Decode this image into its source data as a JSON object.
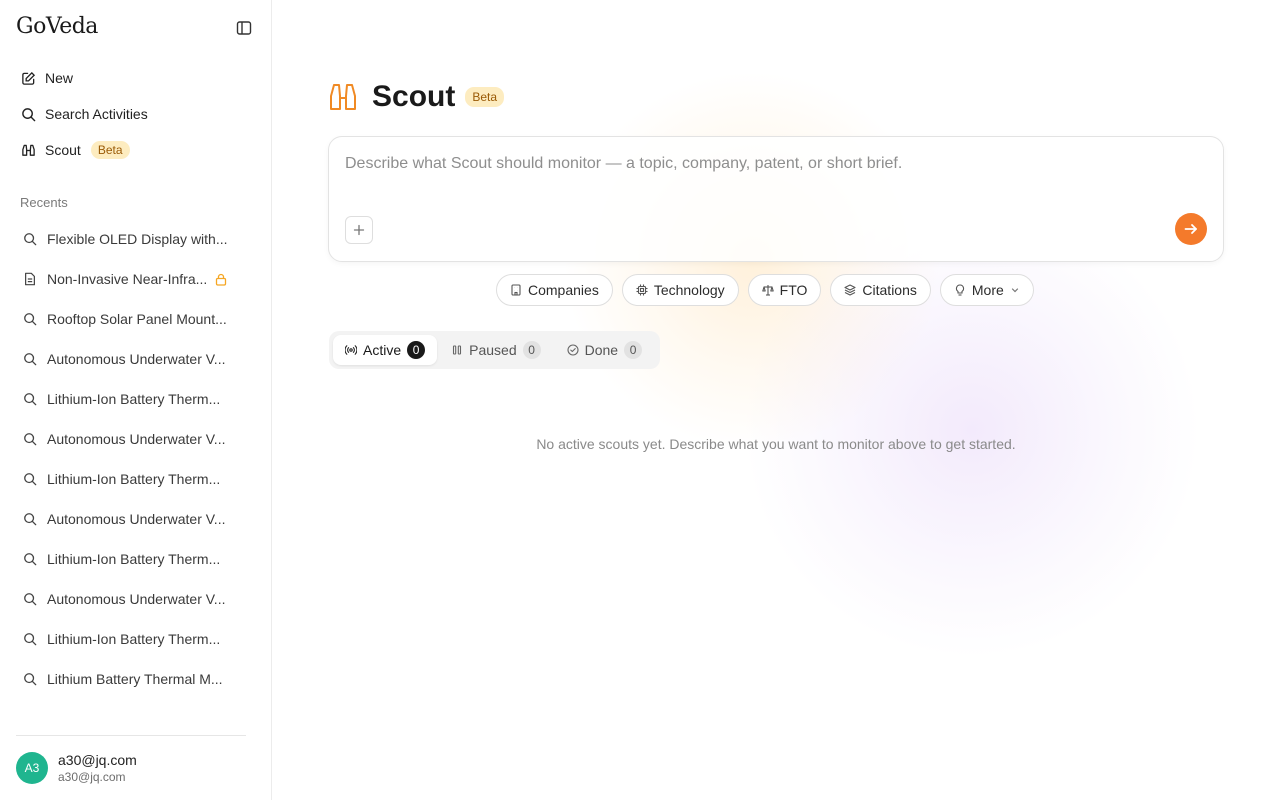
{
  "sidebar": {
    "brand": "GoVeda",
    "nav": {
      "new_label": "New",
      "search_label": "Search Activities",
      "scout_label": "Scout",
      "scout_badge": "Beta"
    },
    "recents_title": "Recents",
    "recents": [
      {
        "label": "Flexible OLED Display with...",
        "icon": "search-icon"
      },
      {
        "label": "Non-Invasive Near-Infra...",
        "icon": "document-icon",
        "locked": true
      },
      {
        "label": "Rooftop Solar Panel Mount...",
        "icon": "search-icon"
      },
      {
        "label": "Autonomous Underwater V...",
        "icon": "search-icon"
      },
      {
        "label": "Lithium-Ion Battery Therm...",
        "icon": "search-icon"
      },
      {
        "label": "Autonomous Underwater V...",
        "icon": "search-icon"
      },
      {
        "label": "Lithium-Ion Battery Therm...",
        "icon": "search-icon"
      },
      {
        "label": "Autonomous Underwater V...",
        "icon": "search-icon"
      },
      {
        "label": "Lithium-Ion Battery Therm...",
        "icon": "search-icon"
      },
      {
        "label": "Autonomous Underwater V...",
        "icon": "search-icon"
      },
      {
        "label": "Lithium-Ion Battery Therm...",
        "icon": "search-icon"
      },
      {
        "label": "Lithium Battery Thermal M...",
        "icon": "search-icon"
      }
    ],
    "user": {
      "initials": "A3",
      "name": "a30@jq.com",
      "email": "a30@jq.com",
      "avatar_color": "#1fb58f"
    }
  },
  "main": {
    "title": "Scout",
    "title_badge": "Beta",
    "composer": {
      "placeholder": "Describe what Scout should monitor — a topic, company, patent, or short brief.",
      "value": ""
    },
    "chips": {
      "companies": "Companies",
      "technology": "Technology",
      "fto": "FTO",
      "citations": "Citations",
      "more": "More"
    },
    "tabs": {
      "active_label": "Active",
      "active_count": "0",
      "paused_label": "Paused",
      "paused_count": "0",
      "done_label": "Done",
      "done_count": "0"
    },
    "empty_message": "No active scouts yet. Describe what you want to monitor above to get started."
  },
  "colors": {
    "accent": "#f47a2b",
    "badge_bg": "#fdecc0",
    "badge_text": "#9a5a06"
  }
}
